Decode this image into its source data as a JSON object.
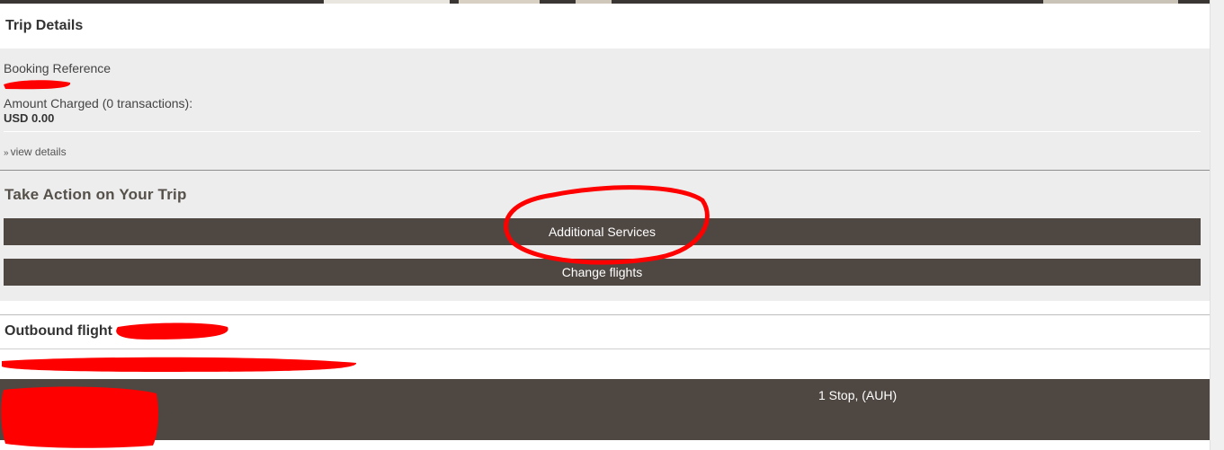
{
  "trip_details": {
    "title": "Trip Details",
    "booking_reference_label": "Booking Reference",
    "amount_charged_label": "Amount Charged (0 transactions):",
    "amount_charged_value": "USD 0.00",
    "view_details_label": "view details",
    "view_details_icon": "double-chevron-down-icon"
  },
  "actions": {
    "title": "Take Action on Your Trip",
    "additional_services_label": "Additional Services",
    "change_flights_label": "Change flights"
  },
  "outbound": {
    "title": "Outbound flight",
    "stops_text": "1 Stop, (AUH)"
  },
  "colors": {
    "button_bg": "#4f4742",
    "panel_bg": "#ededed",
    "annotation_red": "#ff0000"
  }
}
